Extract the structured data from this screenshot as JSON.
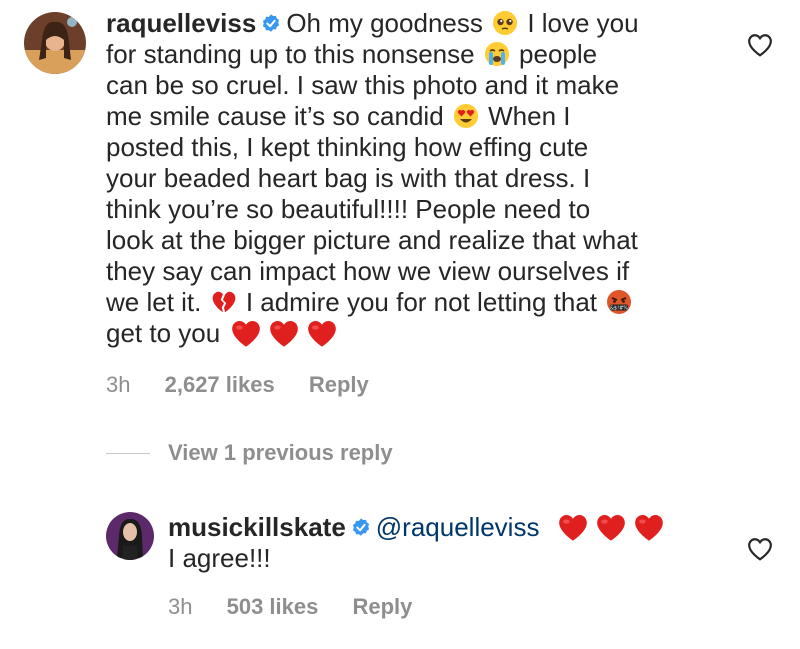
{
  "comment": {
    "username": "raquelleviss",
    "lines": [
      {
        "parts": [
          {
            "t": "Oh my goodness "
          },
          {
            "e": "pleading"
          },
          {
            "t": " I love you"
          }
        ]
      },
      {
        "parts": [
          {
            "t": "for standing up to this nonsense "
          },
          {
            "e": "crying"
          },
          {
            "t": " people"
          }
        ]
      },
      {
        "parts": [
          {
            "t": "can be so cruel. I saw this photo and it make"
          }
        ]
      },
      {
        "parts": [
          {
            "t": "me smile cause it’s so candid "
          },
          {
            "e": "heart-eyes"
          },
          {
            "t": " When I"
          }
        ]
      },
      {
        "parts": [
          {
            "t": "posted this, I kept thinking how effing cute"
          }
        ]
      },
      {
        "parts": [
          {
            "t": "your beaded heart bag is with that dress. I"
          }
        ]
      },
      {
        "parts": [
          {
            "t": "think you’re so beautiful!!!! People need to"
          }
        ]
      },
      {
        "parts": [
          {
            "t": "look at the bigger picture and realize that what"
          }
        ]
      },
      {
        "parts": [
          {
            "t": "they say can impact how we view ourselves if"
          }
        ]
      },
      {
        "parts": [
          {
            "t": "we let it. "
          },
          {
            "e": "broken-heart"
          },
          {
            "t": " I admire you for not letting that "
          },
          {
            "e": "cursing"
          }
        ]
      },
      {
        "parts": [
          {
            "t": "get to you "
          },
          {
            "e": "red-heart"
          },
          {
            "e": "red-heart"
          },
          {
            "e": "red-heart"
          }
        ]
      }
    ],
    "time": "3h",
    "likes": "2,627 likes",
    "reply": "Reply"
  },
  "view_previous": "View 1 previous reply",
  "reply_comment": {
    "username": "musickillskate",
    "mention": "@raquelleviss",
    "text": "I agree!!!",
    "time": "3h",
    "likes": "503 likes",
    "reply": "Reply"
  },
  "colors": {
    "text": "#262626",
    "secondary": "#8e8e8e",
    "verified": "#3897f0",
    "mention": "#00376b"
  },
  "icons": [
    "verified-badge-icon",
    "heart-outline-icon",
    "pleading-face-emoji",
    "crying-face-emoji",
    "heart-eyes-emoji",
    "broken-heart-emoji",
    "cursing-face-emoji",
    "red-heart-emoji"
  ]
}
